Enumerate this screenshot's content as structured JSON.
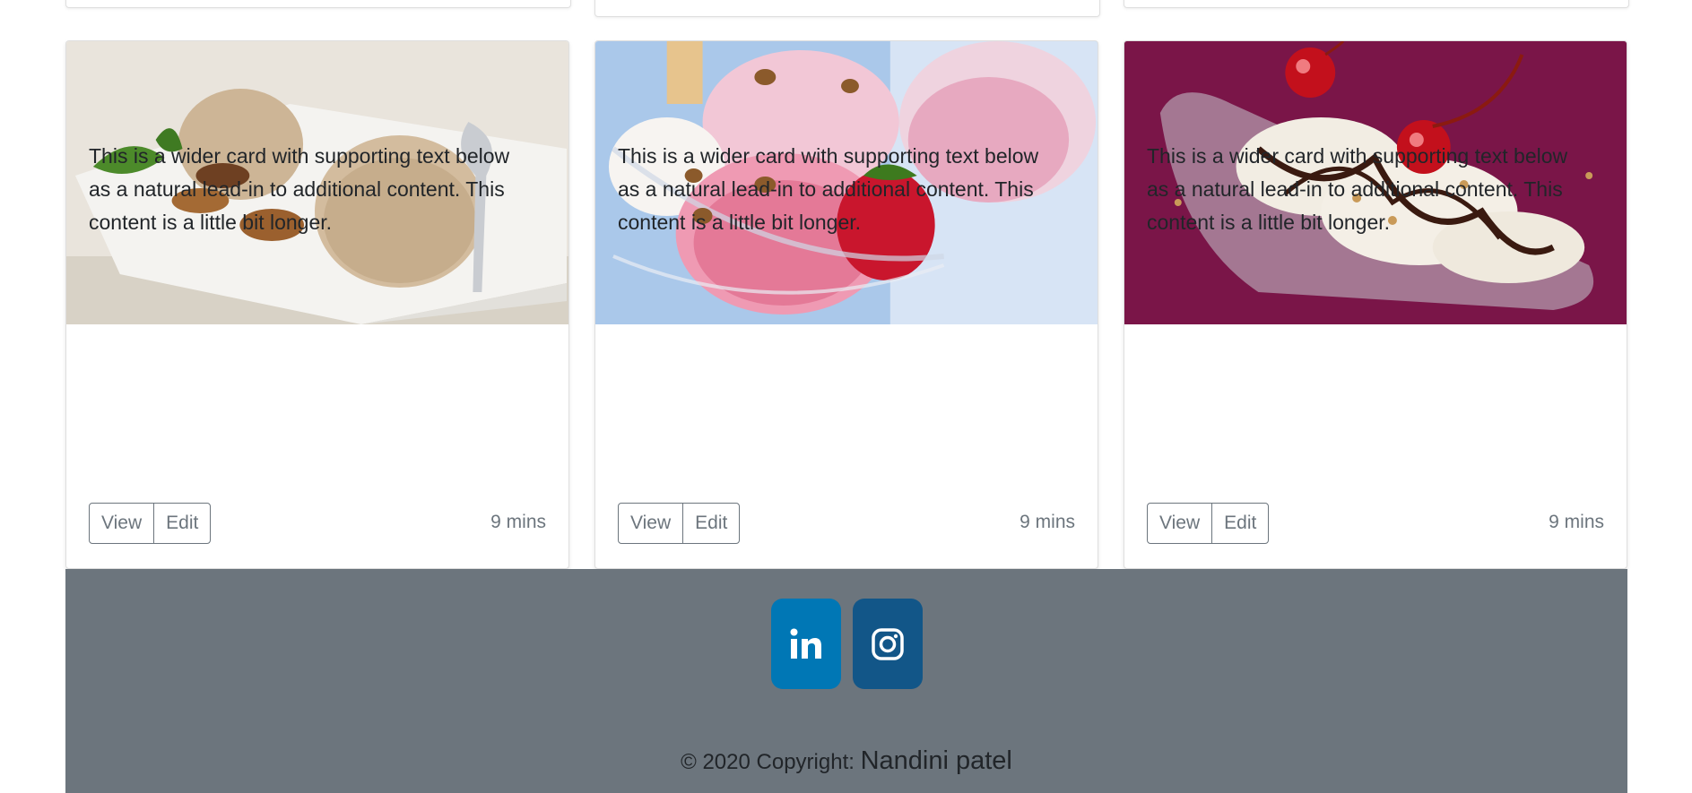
{
  "cards": [
    {
      "image": "ice-cream-scoops-with-nuts-and-mint",
      "text": "This is a wider card with supporting text below as a natural lead-in to additional content. This content is a little bit longer.",
      "view_label": "View",
      "edit_label": "Edit",
      "time": "9 mins"
    },
    {
      "image": "strawberry-ice-cream-sundae",
      "text": "This is a wider card with supporting text below as a natural lead-in to additional content. This content is a little bit longer.",
      "view_label": "View",
      "edit_label": "Edit",
      "time": "9 mins"
    },
    {
      "image": "banana-split-with-cherries",
      "text": "This is a wider card with supporting text below as a natural lead-in to additional content. This content is a little bit longer.",
      "view_label": "View",
      "edit_label": "Edit",
      "time": "9 mins"
    }
  ],
  "footer": {
    "social": [
      {
        "icon": "linkedin-icon",
        "color": "#0077b5"
      },
      {
        "icon": "instagram-icon",
        "color": "#125688"
      }
    ],
    "copyright_prefix": "© 2020 Copyright:",
    "author": "Nandini patel",
    "background": "#6c757d"
  }
}
